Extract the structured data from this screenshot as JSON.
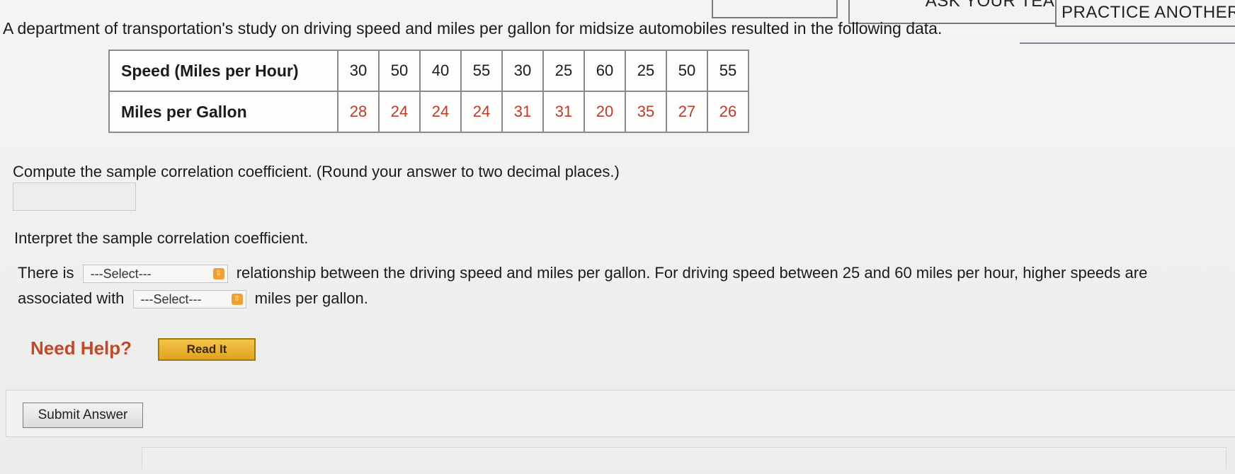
{
  "header": {
    "notes_label": "",
    "ask_teacher_label": "ASK YOUR TEACHER",
    "practice_another_label": "PRACTICE ANOTHER"
  },
  "prompt": "A department of transportation's study on driving speed and miles per gallon for midsize automobiles resulted in the following data.",
  "table": {
    "rows": [
      {
        "label": "Speed (Miles per Hour)",
        "values": [
          "30",
          "50",
          "40",
          "55",
          "30",
          "25",
          "60",
          "25",
          "50",
          "55"
        ]
      },
      {
        "label": "Miles per Gallon",
        "values": [
          "28",
          "24",
          "24",
          "24",
          "31",
          "31",
          "20",
          "35",
          "27",
          "26"
        ]
      }
    ]
  },
  "question": {
    "compute_text": "Compute the sample correlation coefficient. (Round your answer to two decimal places.)",
    "answer_value": "",
    "interpret_text": "Interpret the sample correlation coefficient.",
    "sentence1_pre": "There is",
    "sentence1_post": "relationship between the driving speed and miles per gallon. For driving speed between 25 and 60 miles per hour, higher speeds are",
    "sentence2_pre": "associated with",
    "sentence2_post": "miles per gallon.",
    "select1_value": "---Select---",
    "select2_value": "---Select---"
  },
  "help": {
    "need_help_label": "Need Help?",
    "read_it_label": "Read It"
  },
  "submit": {
    "label": "Submit Answer"
  },
  "colors": {
    "data_red": "#c0392b",
    "need_help": "#c0492b",
    "read_it_bg": "#e9b13a"
  },
  "icons": {
    "select_arrow": "select-arrows-icon"
  }
}
